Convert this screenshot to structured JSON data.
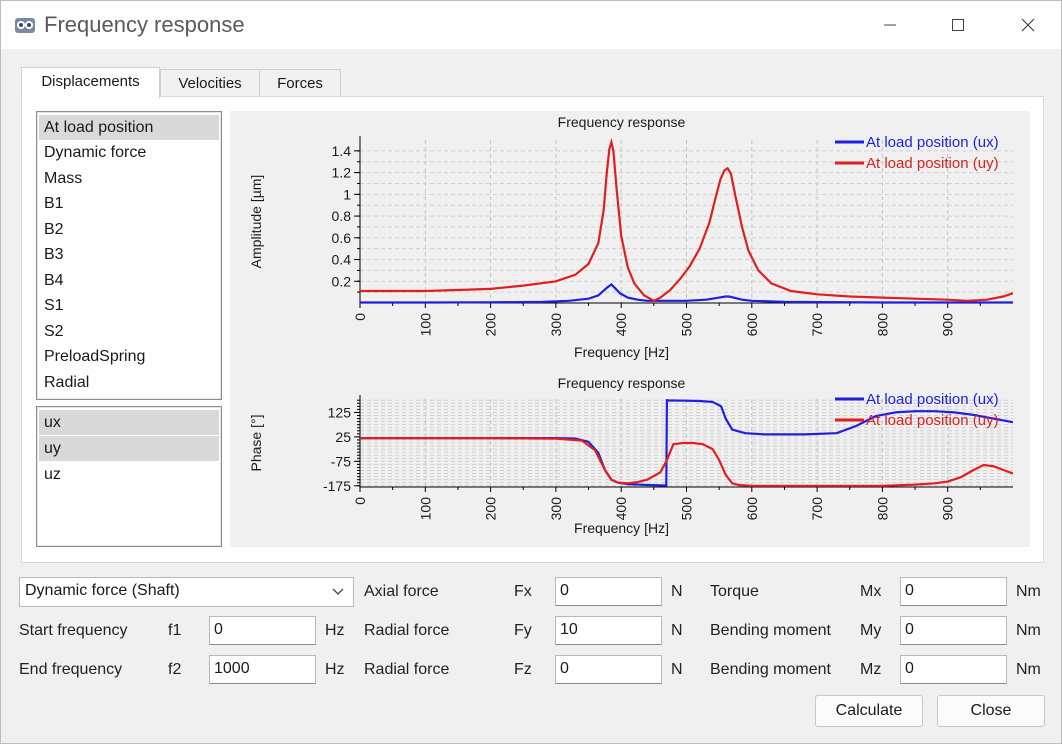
{
  "window": {
    "title": "Frequency response"
  },
  "tabs": [
    "Displacements",
    "Velocities",
    "Forces"
  ],
  "positions": [
    "At load position",
    "Dynamic force",
    "Mass",
    "B1",
    "B2",
    "B3",
    "B4",
    "S1",
    "S2",
    "PreloadSpring",
    "Radial"
  ],
  "directions": [
    "ux",
    "uy",
    "uz"
  ],
  "plot_colors": {
    "ux": "#1f1fe0",
    "uy": "#e01f1f"
  },
  "chart_data": [
    {
      "type": "line",
      "title": "Frequency response",
      "xlabel": "Frequency [Hz]",
      "ylabel": "Amplitude [µm]",
      "xlim": [
        0,
        1000
      ],
      "ylim": [
        0,
        1.5
      ],
      "xticks": [
        "0",
        "100",
        "200",
        "300",
        "400",
        "500",
        "600",
        "700",
        "800",
        "900"
      ],
      "yticks": [
        "0.2",
        "0.4",
        "0.6",
        "0.8",
        "1",
        "1.2",
        "1.4"
      ],
      "grid": true,
      "legend_position": "top-right",
      "series": [
        {
          "name": "At load position (ux)",
          "x": [
            0,
            100,
            200,
            280,
            320,
            350,
            365,
            378,
            385,
            390,
            398,
            410,
            425,
            440,
            455,
            470,
            500,
            530,
            550,
            560,
            565,
            572,
            585,
            600,
            650,
            700,
            800,
            900,
            1000
          ],
          "y": [
            0.005,
            0.005,
            0.006,
            0.01,
            0.02,
            0.04,
            0.07,
            0.14,
            0.17,
            0.14,
            0.09,
            0.05,
            0.03,
            0.02,
            0.02,
            0.02,
            0.02,
            0.03,
            0.05,
            0.06,
            0.06,
            0.05,
            0.03,
            0.02,
            0.01,
            0.008,
            0.005,
            0.005,
            0.005
          ]
        },
        {
          "name": "At load position (uy)",
          "x": [
            0,
            50,
            100,
            150,
            200,
            250,
            300,
            330,
            350,
            365,
            373,
            378,
            382,
            385,
            388,
            393,
            400,
            410,
            420,
            435,
            450,
            460,
            475,
            490,
            505,
            520,
            535,
            545,
            552,
            558,
            563,
            568,
            575,
            585,
            595,
            610,
            630,
            660,
            700,
            750,
            800,
            850,
            900,
            930,
            960,
            985,
            1000
          ],
          "y": [
            0.11,
            0.11,
            0.11,
            0.12,
            0.13,
            0.16,
            0.2,
            0.26,
            0.36,
            0.55,
            0.85,
            1.2,
            1.42,
            1.48,
            1.4,
            1.05,
            0.62,
            0.33,
            0.18,
            0.07,
            0.02,
            0.05,
            0.12,
            0.22,
            0.34,
            0.5,
            0.74,
            0.98,
            1.14,
            1.22,
            1.24,
            1.19,
            0.98,
            0.7,
            0.48,
            0.3,
            0.18,
            0.11,
            0.08,
            0.06,
            0.05,
            0.04,
            0.03,
            0.02,
            0.03,
            0.06,
            0.09
          ]
        }
      ]
    },
    {
      "type": "line",
      "title": "Frequency response",
      "xlabel": "Frequency [Hz]",
      "ylabel": "Phase [°]",
      "xlim": [
        0,
        1000
      ],
      "ylim": [
        -180,
        180
      ],
      "xticks": [
        "0",
        "100",
        "200",
        "300",
        "400",
        "500",
        "600",
        "700",
        "800",
        "900"
      ],
      "yticks": [
        "-175",
        "-75",
        "25",
        "125"
      ],
      "grid": true,
      "legend_position": "top-right",
      "series": [
        {
          "name": "At load position (ux)",
          "x": [
            0,
            100,
            200,
            300,
            330,
            350,
            365,
            375,
            385,
            395,
            410,
            440,
            469,
            470,
            472,
            480,
            500,
            520,
            540,
            553,
            560,
            570,
            590,
            620,
            680,
            730,
            760,
            790,
            820,
            850,
            880,
            910,
            940,
            970,
            1000
          ],
          "y": [
            20,
            20,
            20,
            20,
            18,
            5,
            -40,
            -110,
            -150,
            -162,
            -168,
            -172,
            -174,
            175,
            174,
            174,
            173,
            172,
            168,
            150,
            100,
            55,
            40,
            35,
            35,
            40,
            70,
            110,
            125,
            130,
            130,
            125,
            115,
            100,
            85
          ]
        },
        {
          "name": "At load position (uy)",
          "x": [
            0,
            100,
            200,
            300,
            340,
            360,
            375,
            385,
            395,
            410,
            425,
            440,
            460,
            470,
            480,
            495,
            510,
            525,
            540,
            550,
            560,
            570,
            580,
            600,
            700,
            800,
            850,
            880,
            900,
            920,
            940,
            955,
            970,
            985,
            1000
          ],
          "y": [
            20,
            20,
            20,
            18,
            10,
            -30,
            -110,
            -150,
            -162,
            -165,
            -160,
            -150,
            -120,
            -70,
            -5,
            0,
            0,
            -5,
            -25,
            -70,
            -130,
            -165,
            -172,
            -175,
            -175,
            -175,
            -170,
            -165,
            -158,
            -140,
            -110,
            -90,
            -95,
            -110,
            -125
          ]
        }
      ]
    }
  ],
  "params": {
    "load_type": "Dynamic force (Shaft)",
    "start_frequency": {
      "label": "Start frequency",
      "symbol": "f1",
      "value": "0",
      "unit": "Hz"
    },
    "end_frequency": {
      "label": "End frequency",
      "symbol": "f2",
      "value": "1000",
      "unit": "Hz"
    },
    "fx": {
      "label": "Axial force",
      "symbol": "Fx",
      "value": "0",
      "unit": "N"
    },
    "fy": {
      "label": "Radial force",
      "symbol": "Fy",
      "value": "10",
      "unit": "N"
    },
    "fz": {
      "label": "Radial force",
      "symbol": "Fz",
      "value": "0",
      "unit": "N"
    },
    "mx": {
      "label": "Torque",
      "symbol": "Mx",
      "value": "0",
      "unit": "Nm"
    },
    "my": {
      "label": "Bending moment",
      "symbol": "My",
      "value": "0",
      "unit": "Nm"
    },
    "mz": {
      "label": "Bending moment",
      "symbol": "Mz",
      "value": "0",
      "unit": "Nm"
    }
  },
  "buttons": {
    "calculate": "Calculate",
    "close": "Close"
  }
}
